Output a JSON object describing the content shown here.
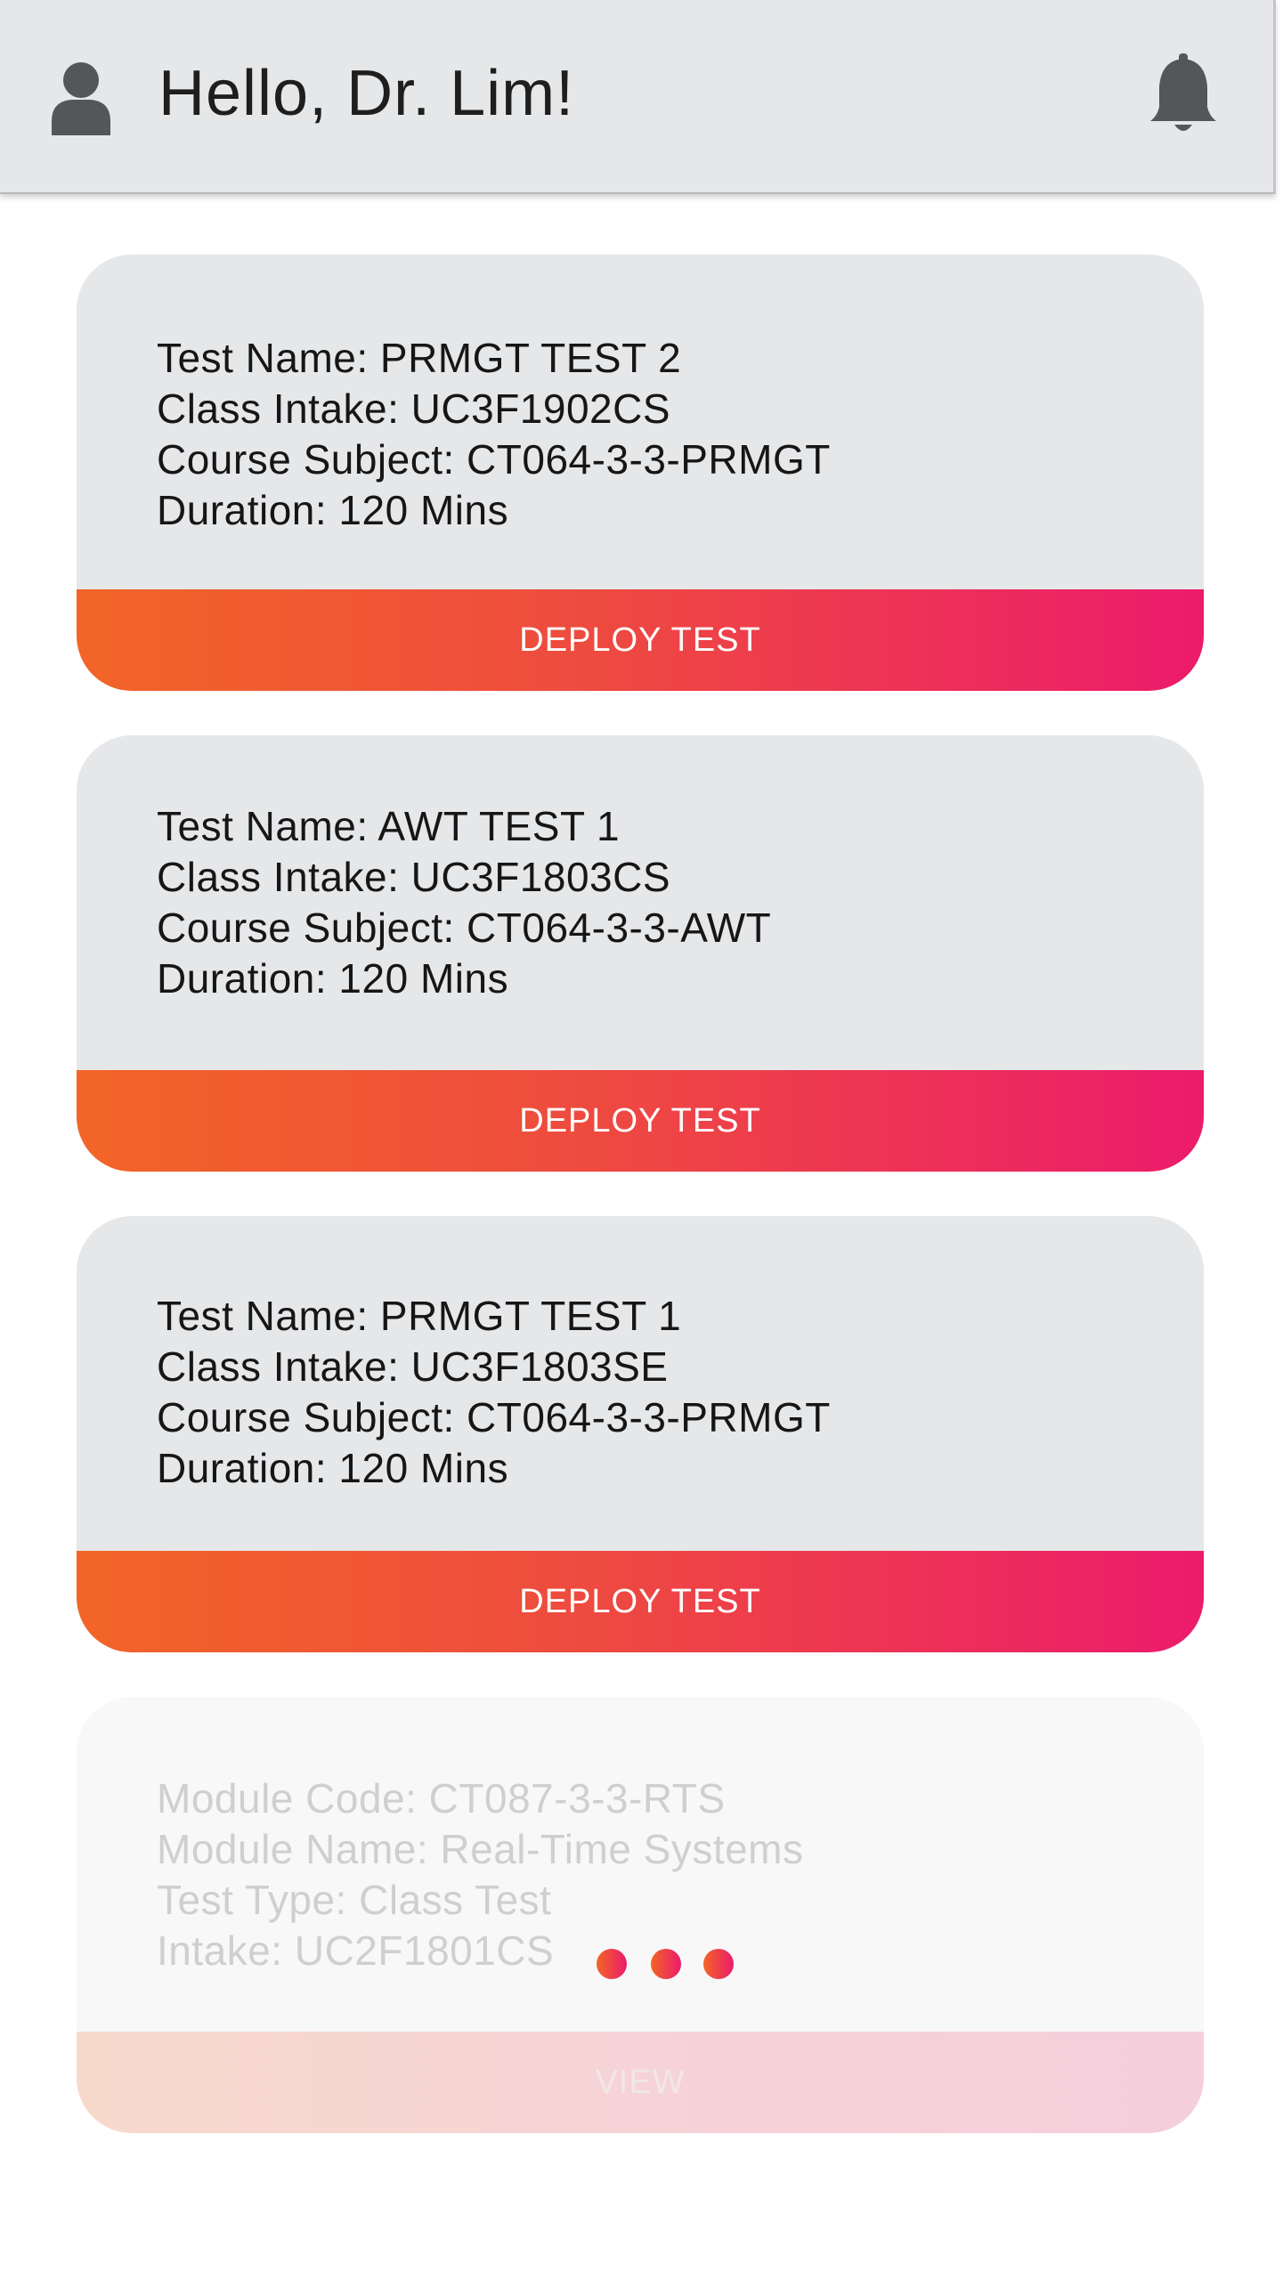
{
  "header": {
    "greeting": "Hello, Dr. Lim!",
    "avatar_icon": "user-icon",
    "notification_icon": "bell-icon"
  },
  "cards": [
    {
      "lines": [
        "Test Name: PRMGT TEST 2",
        "Class Intake: UC3F1902CS",
        "Course Subject: CT064-3-3-PRMGT",
        "Duration: 120 Mins"
      ],
      "button_label": "DEPLOY TEST"
    },
    {
      "lines": [
        "Test Name: AWT TEST 1",
        "Class Intake: UC3F1803CS",
        "Course Subject: CT064-3-3-AWT",
        "Duration: 120 Mins"
      ],
      "button_label": "DEPLOY TEST"
    },
    {
      "lines": [
        "Test Name: PRMGT TEST 1",
        "Class Intake: UC3F1803SE",
        "Course Subject: CT064-3-3-PRMGT",
        "Duration: 120 Mins"
      ],
      "button_label": "DEPLOY TEST"
    },
    {
      "lines": [
        "Module Code: CT087-3-3-RTS",
        "Module Name: Real-Time Systems",
        "Test Type: Class Test",
        "Intake: UC2F1801CS"
      ],
      "button_label": "VIEW",
      "loading_icon": "loading-dots-icon"
    }
  ],
  "colors": {
    "accent_start": "#f26527",
    "accent_end": "#ec1b6c",
    "card_bg": "#e6e7e9"
  }
}
